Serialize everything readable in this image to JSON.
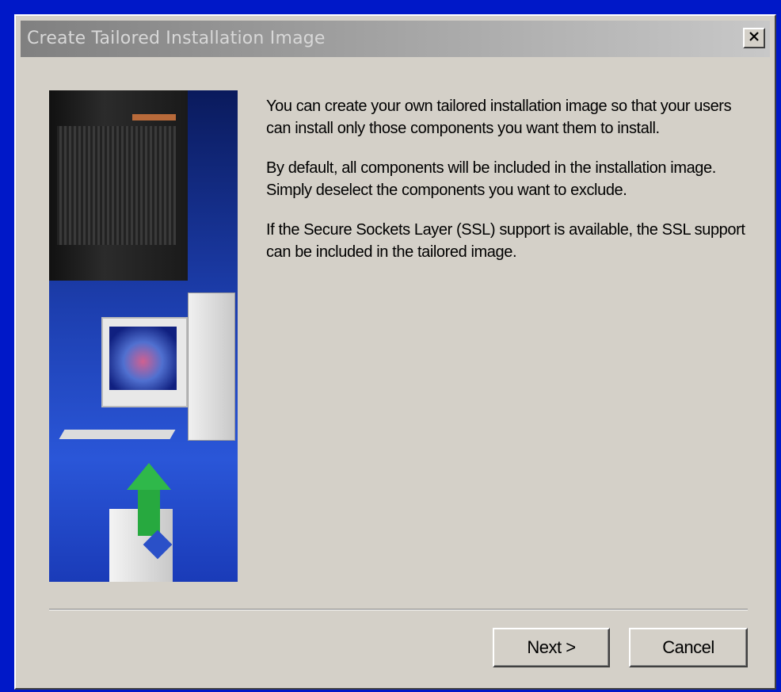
{
  "window": {
    "title": "Create Tailored Installation Image",
    "close_label": "X"
  },
  "content": {
    "paragraphs": [
      "You can create your own tailored installation image so that your users can install only those components you want them to install.",
      "By default, all components will be included in the installation image.  Simply deselect the components you want to exclude.",
      "If the Secure Sockets Layer (SSL) support is available, the SSL support can be included in the tailored image."
    ]
  },
  "buttons": {
    "next_label": "Next >",
    "cancel_label": "Cancel"
  },
  "colors": {
    "desktop": "#0018c8",
    "dialog_face": "#d4d0c8",
    "arrow": "#2fb84a"
  },
  "icons": {
    "close": "close-icon",
    "side_image": "installation-wizard-illustration"
  }
}
